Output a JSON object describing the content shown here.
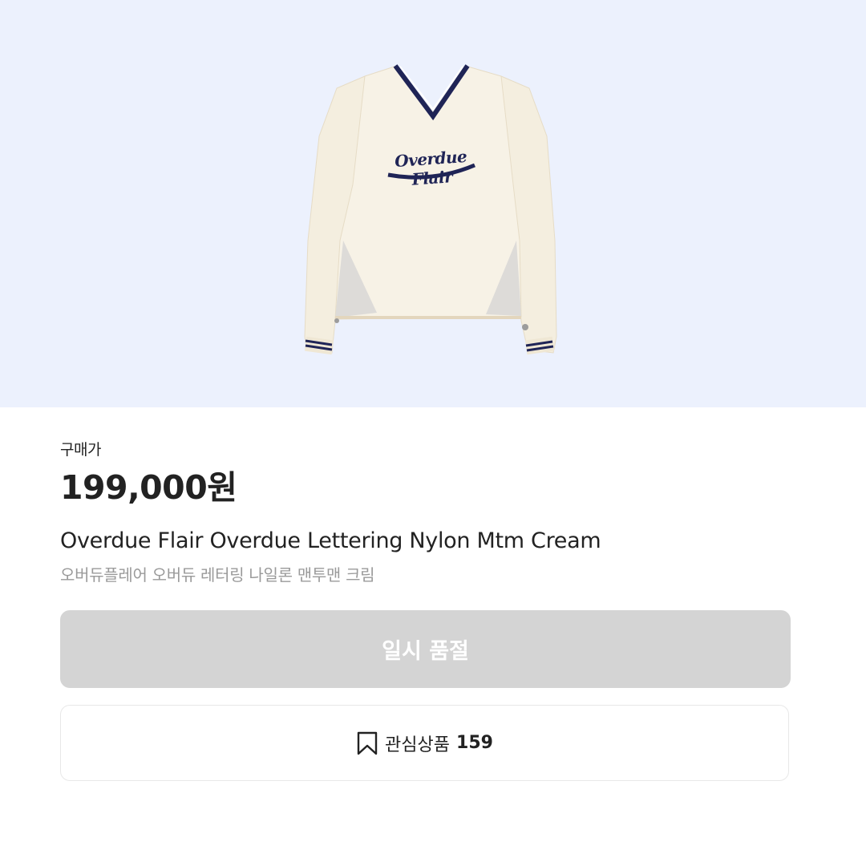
{
  "product": {
    "image_alt": "Overdue Flair cream v-neck nylon pullover",
    "print_text": "Overdue Flair",
    "price_label": "구매가",
    "price": "199,000원",
    "name_en": "Overdue Flair Overdue Lettering Nylon Mtm Cream",
    "name_ko": "오버듀플레어 오버듀 레터링 나일론 맨투맨 크림"
  },
  "actions": {
    "soldout_label": "일시 품절",
    "wish_label": "관심상품",
    "wish_count": "159"
  },
  "colors": {
    "hero_bg": "#ecf1fd",
    "garment": "#f7f2e6",
    "trim_navy": "#1f2456",
    "soldout_bg": "#d4d4d4"
  },
  "icons": {
    "wish": "bookmark-icon"
  }
}
